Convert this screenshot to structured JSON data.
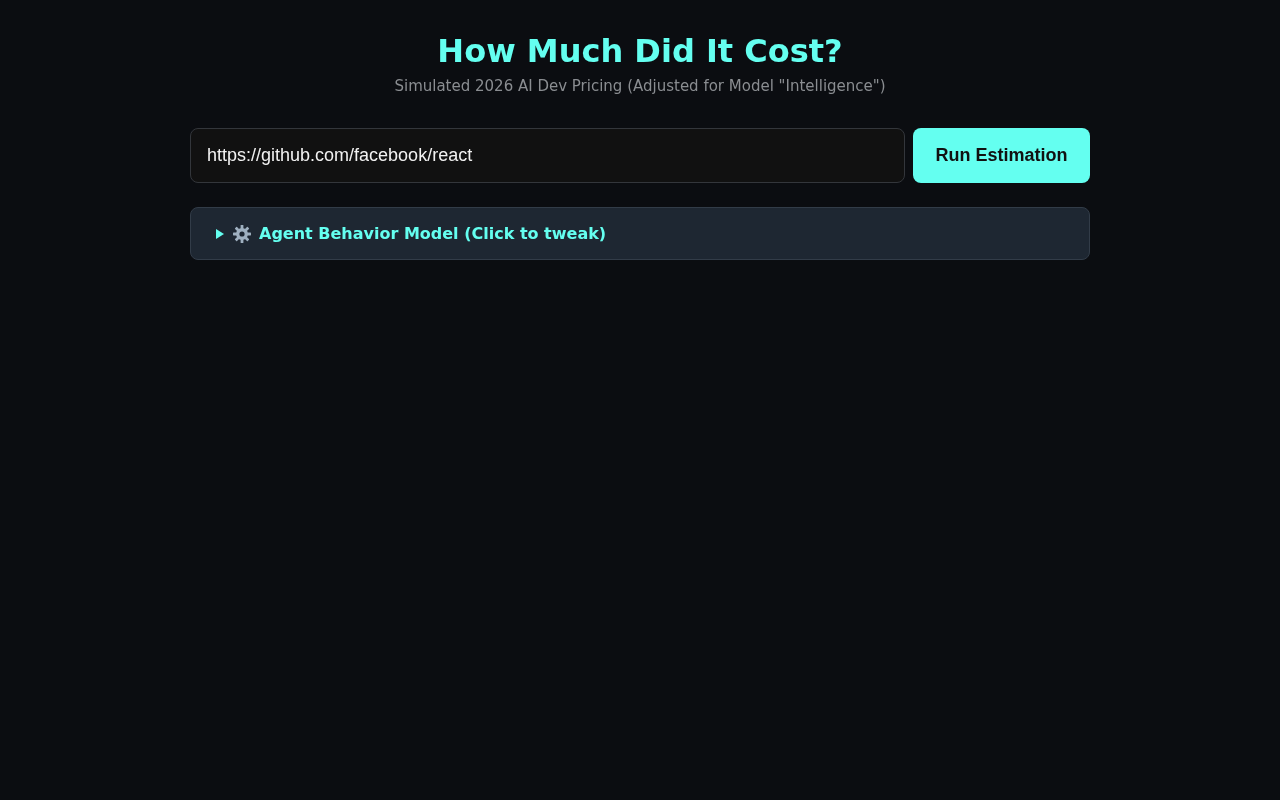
{
  "header": {
    "title": "How Much Did It Cost?",
    "subtitle": "Simulated 2026 AI Dev Pricing (Adjusted for Model \"Intelligence\")"
  },
  "repo_input": {
    "value": "https://github.com/facebook/react"
  },
  "run_button": {
    "label": "Run Estimation"
  },
  "settings_panel": {
    "summary": "Agent Behavior Model (Click to tweak)",
    "expanded": false
  }
}
